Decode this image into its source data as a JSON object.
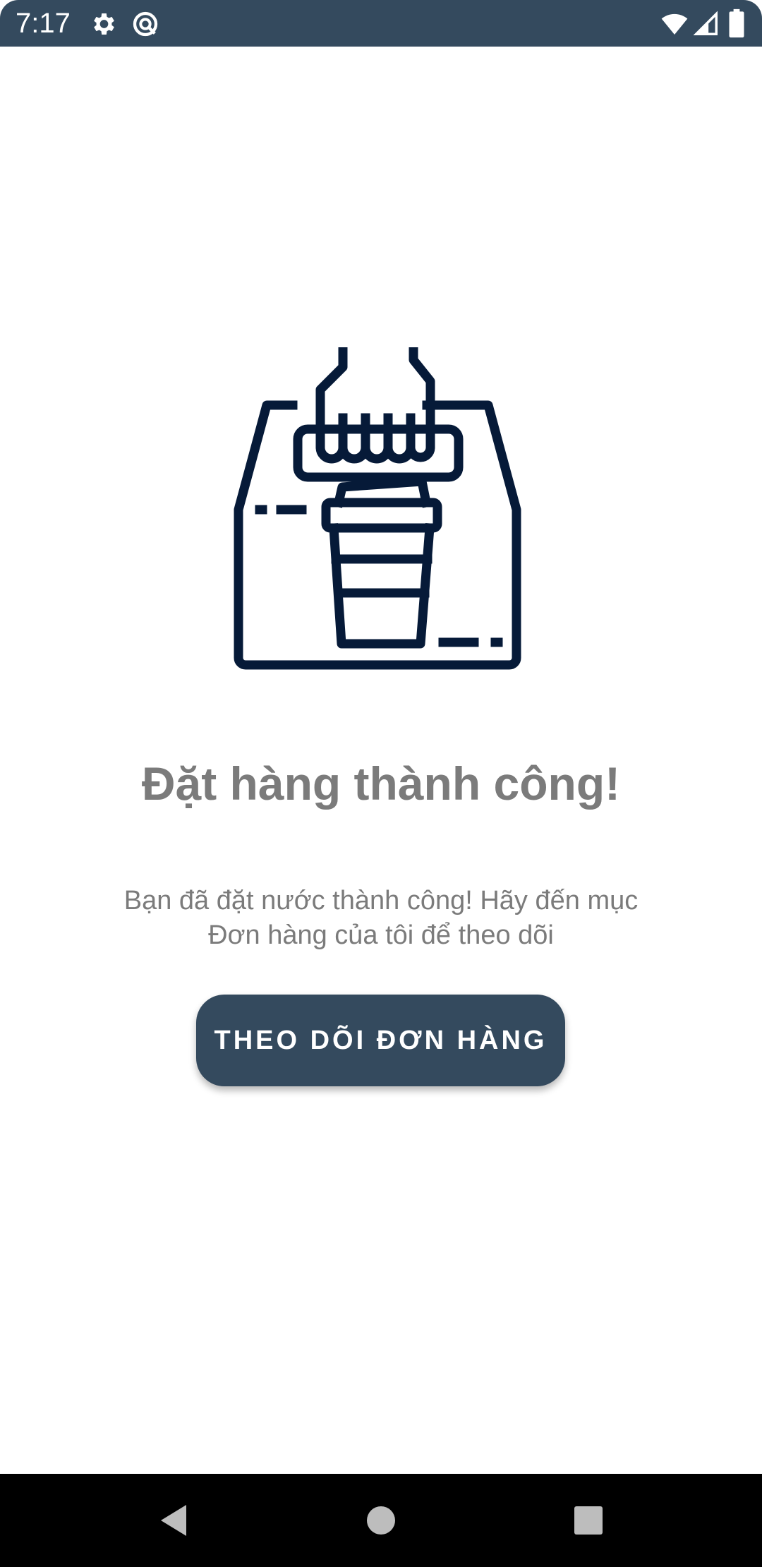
{
  "status_bar": {
    "time": "7:17",
    "icons": [
      "gear-icon",
      "no-data-sync-icon",
      "wifi-icon",
      "signal-icon",
      "battery-icon"
    ],
    "background_color": "#344a5e"
  },
  "illustration": {
    "icon": "coffee-takeaway-box-icon",
    "color": "#061a38"
  },
  "main": {
    "title": "Đặt hàng thành công!",
    "message_line1": "Bạn đã đặt nước thành công! Hãy đến mục",
    "message_line2": "Đơn hàng của tôi để theo dõi",
    "button_label": "THEO DÕI ĐƠN HÀNG",
    "text_color": "#7b7b7b",
    "button_color": "#344a5e"
  },
  "nav_bar": {
    "buttons": [
      "back-icon",
      "home-icon",
      "recents-icon"
    ]
  }
}
